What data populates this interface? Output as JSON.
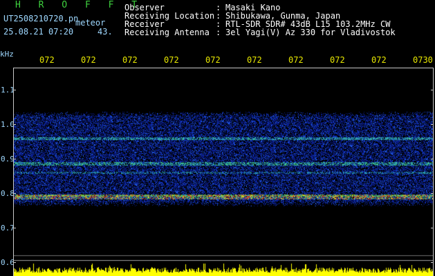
{
  "header": {
    "logo": "H R O F F T",
    "filename": "UT2508210720.pn",
    "meteor_label": "meteor",
    "datetime": "25.08.21 07:20",
    "count": "43."
  },
  "info": {
    "rows": [
      {
        "label": "Observer",
        "value": "Masaki Kano"
      },
      {
        "label": "Receiving Location",
        "value": "Shibukawa, Gunma, Japan"
      },
      {
        "label": "Receiver",
        "value": "RTL-SDR SDR# 43dB L15 103.2MHz CW"
      },
      {
        "label": "Receiving Antenna",
        "value": "3el Yagi(V) Az 330 for Vladivostok"
      }
    ],
    "separator": ":"
  },
  "axis": {
    "unit": "kHz",
    "time_ticks": [
      "072",
      "072",
      "072",
      "072",
      "072",
      "072",
      "072",
      "072",
      "072",
      "0730"
    ],
    "khz_ticks": [
      "1.1",
      "1.0",
      "0.9",
      "0.8",
      "0.7",
      "0.6"
    ]
  },
  "colors": {
    "background": "#000000",
    "baseline_bars": "#ffff00",
    "frame": "#c9c9c9",
    "info_text": "#ffffff",
    "logo": "#3fd23f",
    "time_ticks": "#e8e800"
  }
}
